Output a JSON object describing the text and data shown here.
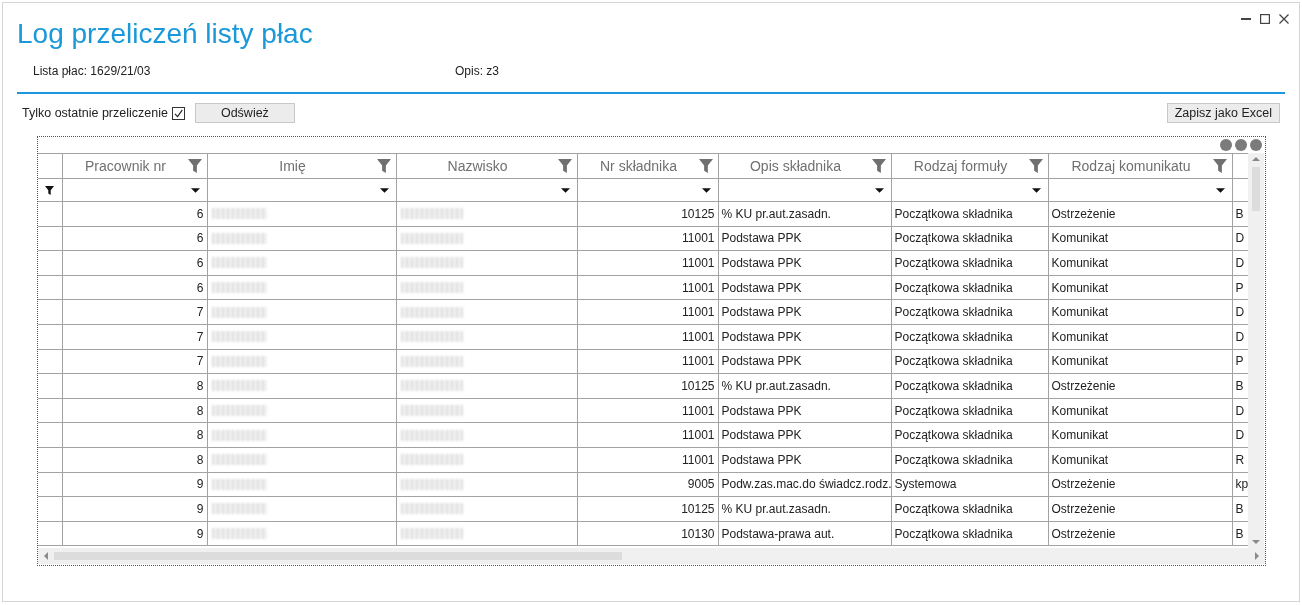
{
  "window": {
    "title": "Log przeliczeń listy płac"
  },
  "info": [
    "Lista płac: 1629/21/03",
    "Opis: z3"
  ],
  "toolbar": {
    "only_last": {
      "label": "Tylko ostatnie przeliczenie",
      "checked": true
    },
    "refresh_button": "Odśwież",
    "export_button": "Zapisz jako Excel"
  },
  "table": {
    "columns": [
      "Pracownik nr",
      "Imię",
      "Nazwisko",
      "Nr składnika",
      "Opis składnika",
      "Rodzaj formuły",
      "Rodzaj komunikatu"
    ],
    "rows": [
      {
        "employee_nr": "6",
        "component_nr": "10125",
        "component_desc": "% KU pr.aut.zasadn.",
        "formula_type": "Początkowa składnika",
        "message_type": "Ostrzeżenie",
        "column_8": "B"
      },
      {
        "employee_nr": "6",
        "component_nr": "11001",
        "component_desc": "Podstawa PPK",
        "formula_type": "Początkowa składnika",
        "message_type": "Komunikat",
        "column_8": "D"
      },
      {
        "employee_nr": "6",
        "component_nr": "11001",
        "component_desc": "Podstawa PPK",
        "formula_type": "Początkowa składnika",
        "message_type": "Komunikat",
        "column_8": "D"
      },
      {
        "employee_nr": "6",
        "component_nr": "11001",
        "component_desc": "Podstawa PPK",
        "formula_type": "Początkowa składnika",
        "message_type": "Komunikat",
        "column_8": "P"
      },
      {
        "employee_nr": "7",
        "component_nr": "11001",
        "component_desc": "Podstawa PPK",
        "formula_type": "Początkowa składnika",
        "message_type": "Komunikat",
        "column_8": "D"
      },
      {
        "employee_nr": "7",
        "component_nr": "11001",
        "component_desc": "Podstawa PPK",
        "formula_type": "Początkowa składnika",
        "message_type": "Komunikat",
        "column_8": "D"
      },
      {
        "employee_nr": "7",
        "component_nr": "11001",
        "component_desc": "Podstawa PPK",
        "formula_type": "Początkowa składnika",
        "message_type": "Komunikat",
        "column_8": "P"
      },
      {
        "employee_nr": "8",
        "component_nr": "10125",
        "component_desc": "% KU pr.aut.zasadn.",
        "formula_type": "Początkowa składnika",
        "message_type": "Ostrzeżenie",
        "column_8": "B"
      },
      {
        "employee_nr": "8",
        "component_nr": "11001",
        "component_desc": "Podstawa PPK",
        "formula_type": "Początkowa składnika",
        "message_type": "Komunikat",
        "column_8": "D"
      },
      {
        "employee_nr": "8",
        "component_nr": "11001",
        "component_desc": "Podstawa PPK",
        "formula_type": "Początkowa składnika",
        "message_type": "Komunikat",
        "column_8": "D"
      },
      {
        "employee_nr": "8",
        "component_nr": "11001",
        "component_desc": "Podstawa PPK",
        "formula_type": "Początkowa składnika",
        "message_type": "Komunikat",
        "column_8": "R"
      },
      {
        "employee_nr": "9",
        "component_nr": "9005",
        "component_desc": "Podw.zas.mac.do świadcz.rodz.",
        "formula_type": "Systemowa",
        "message_type": "Ostrzeżenie",
        "column_8": "kp"
      },
      {
        "employee_nr": "9",
        "component_nr": "10125",
        "component_desc": "% KU pr.aut.zasadn.",
        "formula_type": "Początkowa składnika",
        "message_type": "Ostrzeżenie",
        "column_8": "B"
      },
      {
        "employee_nr": "9",
        "component_nr": "10130",
        "component_desc": "Podstawa-prawa aut.",
        "formula_type": "Początkowa składnika",
        "message_type": "Ostrzeżenie",
        "column_8": "B"
      }
    ]
  }
}
